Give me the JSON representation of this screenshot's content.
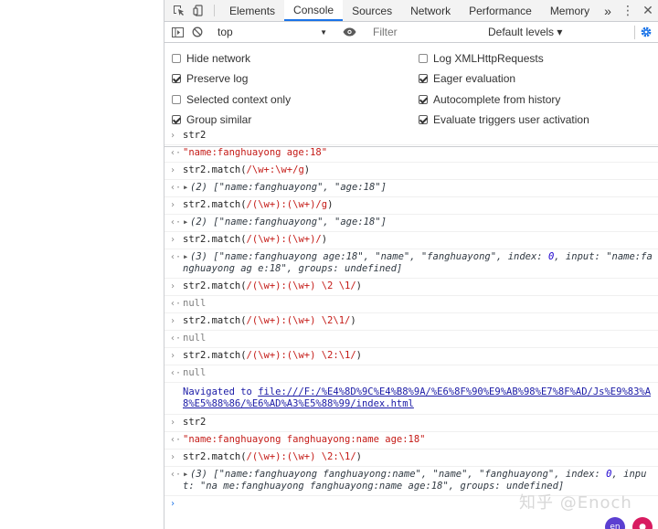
{
  "tabs": [
    "Elements",
    "Console",
    "Sources",
    "Network",
    "Performance",
    "Memory"
  ],
  "more_tabs": "»",
  "active_tab": "Console",
  "toolbar": {
    "context": "top",
    "filter_placeholder": "Filter",
    "levels": "Default levels ▾"
  },
  "settings": {
    "left": [
      {
        "label": "Hide network",
        "checked": false
      },
      {
        "label": "Preserve log",
        "checked": true
      },
      {
        "label": "Selected context only",
        "checked": false
      },
      {
        "label": "Group similar",
        "checked": true
      }
    ],
    "right": [
      {
        "label": "Log XMLHttpRequests",
        "checked": false
      },
      {
        "label": "Eager evaluation",
        "checked": true
      },
      {
        "label": "Autocomplete from history",
        "checked": true
      },
      {
        "label": "Evaluate triggers user activation",
        "checked": true
      }
    ]
  },
  "console": {
    "r1_in": "str2",
    "r1_out": "\"name:fanghuayong age:18\"",
    "r2_in_a": "str2.match(",
    "r2_in_re": "/\\w+:\\w+/g",
    "r2_in_b": ")",
    "r2_out_count": "(2) [",
    "r2_out_items": "\"name:fanghuayong\", \"age:18\"",
    "r2_out_end": "]",
    "r3_in_a": "str2.match(",
    "r3_in_re": "/(\\w+):(\\w+)/g",
    "r3_in_b": ")",
    "r3_out_count": "(2) [",
    "r3_out_items": "\"name:fanghuayong\", \"age:18\"",
    "r3_out_end": "]",
    "r4_in_a": "str2.match(",
    "r4_in_re": "/(\\w+):(\\w+)/",
    "r4_in_b": ")",
    "r4_out_1": "(3) [",
    "r4_out_2": "\"name:fanghuayong age:18\", \"name\", \"fanghuayong\"",
    "r4_out_3": ", index: ",
    "r4_out_4": "0",
    "r4_out_5": ", input: ",
    "r4_out_6": "\"name:fanghuayong ag e:18\"",
    "r4_out_7": ", groups: undefined]",
    "r5_in_a": "str2.match(",
    "r5_in_re": "/(\\w+):(\\w+) \\2 \\1/",
    "r5_in_b": ")",
    "r5_out": "null",
    "r6_in_a": "str2.match(",
    "r6_in_re": "/(\\w+):(\\w+) \\2\\1/",
    "r6_in_b": ")",
    "r6_out": "null",
    "r7_in_a": "str2.match(",
    "r7_in_re": "/(\\w+):(\\w+) \\2:\\1/",
    "r7_in_b": ")",
    "r7_out": "null",
    "nav_text": "Navigated to ",
    "nav_url": "file:///F:/%E4%8D%9C%E4%B8%9A/%E6%8F%90%E9%AB%98%E7%8F%AD/Js%E9%83%A8%E5%88%86/%E6%AD%A3%E5%88%99/index.html",
    "r8_in": "str2",
    "r8_out": "\"name:fanghuayong fanghuayong:name age:18\"",
    "r9_in_a": "str2.match(",
    "r9_in_re": "/(\\w+):(\\w+) \\2:\\1/",
    "r9_in_b": ")",
    "r9_out_1": "(3) [",
    "r9_out_2": "\"name:fanghuayong fanghuayong:name\", \"name\", \"fanghuayong\"",
    "r9_out_3": ", index: ",
    "r9_out_4": "0",
    "r9_out_5": ", input: ",
    "r9_out_6": "\"na me:fanghuayong fanghuayong:name age:18\"",
    "r9_out_7": ", groups: undefined]"
  },
  "watermark": "知乎 @Enoch",
  "badge_en": "en",
  "colors": {
    "accent": "#1a73e8",
    "string": "#c41a16",
    "number": "#1c00cf"
  }
}
